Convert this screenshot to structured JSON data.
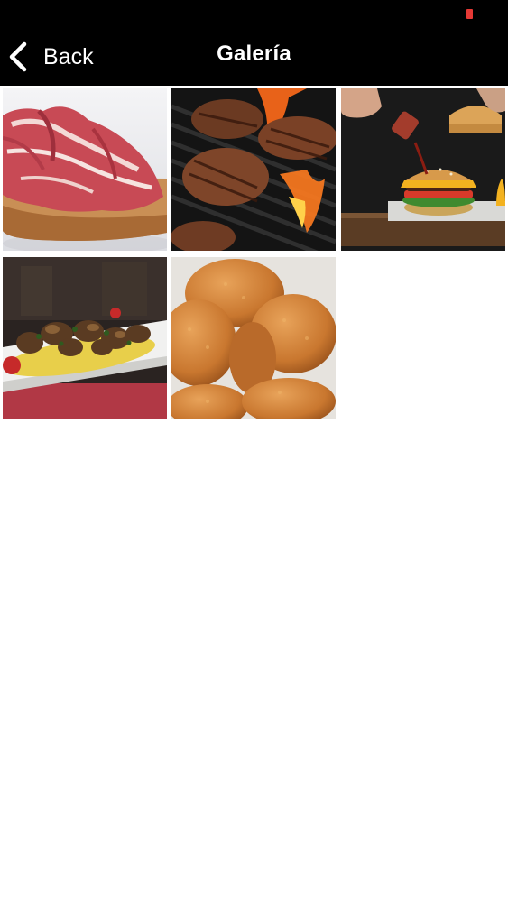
{
  "status_bar": {
    "battery_color": "#e53935"
  },
  "header": {
    "back_label": "Back",
    "back_icon": "chevron-left-icon",
    "title": "Galería"
  },
  "gallery": {
    "photos": [
      {
        "subject": "jamon-toast"
      },
      {
        "subject": "grilled-burger-patties"
      },
      {
        "subject": "burger-with-sauce"
      },
      {
        "subject": "mushroom-plate"
      },
      {
        "subject": "croquettes"
      }
    ]
  }
}
